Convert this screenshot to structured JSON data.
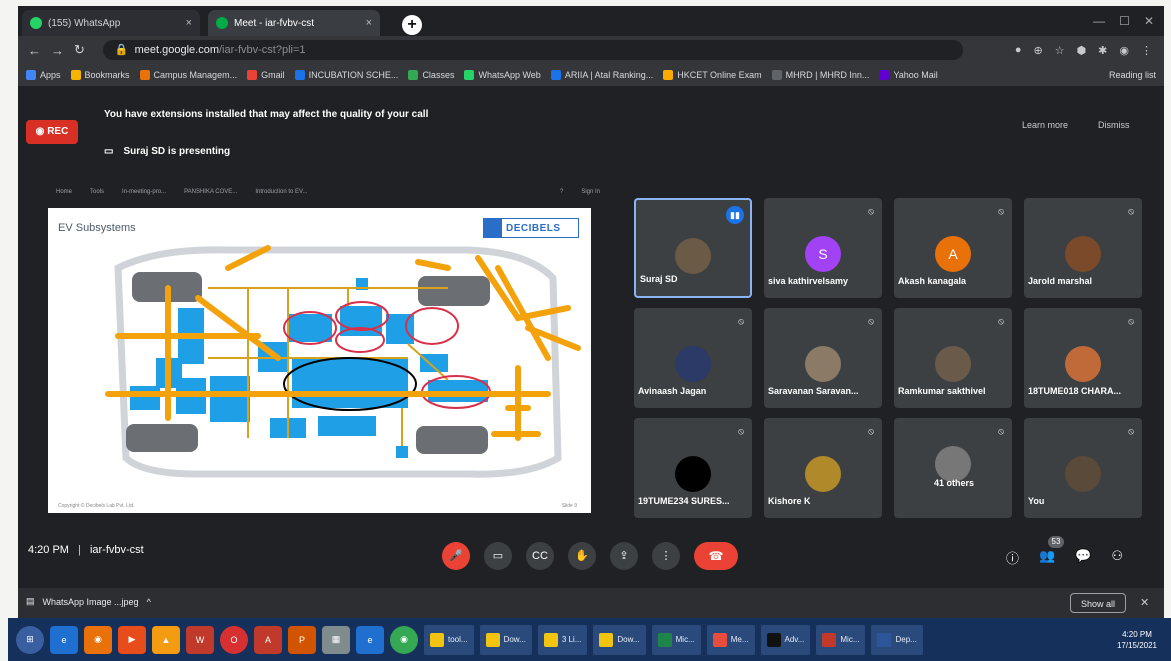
{
  "browser": {
    "tabs": [
      {
        "label": "(155) WhatsApp",
        "close": "×",
        "favicon_color": "#25d366"
      },
      {
        "label": "Meet - iar-fvbv-cst",
        "close": "×",
        "favicon_color": "#00ac47"
      }
    ],
    "new_tab": "+",
    "window_controls": [
      "—",
      "☐",
      "✕"
    ],
    "nav": {
      "back": "←",
      "forward": "→",
      "reload": "↻"
    },
    "url_host": "meet.google.com",
    "url_path": "/iar-fvbv-cst?pli=1",
    "toolbar_icons": [
      "●",
      "⊕",
      "☆",
      "⬢",
      "✱",
      "◉",
      "⋮"
    ],
    "bookmarks": [
      {
        "label": "Apps",
        "color": "#4285f4"
      },
      {
        "label": "Bookmarks",
        "color": "#f4b400"
      },
      {
        "label": "Campus Managem...",
        "color": "#e8710a"
      },
      {
        "label": "Gmail",
        "color": "#ea4335"
      },
      {
        "label": "INCUBATION SCHE...",
        "color": "#1a73e8"
      },
      {
        "label": "Classes",
        "color": "#34a853"
      },
      {
        "label": "WhatsApp Web",
        "color": "#25d366"
      },
      {
        "label": "ARIIA | Atal Ranking...",
        "color": "#1a73e8"
      },
      {
        "label": "HKCET Online Exam",
        "color": "#f9ab00"
      },
      {
        "label": "MHRD | MHRD Inn...",
        "color": "#5f6368"
      },
      {
        "label": "Yahoo Mail",
        "color": "#6001d2"
      }
    ],
    "reading_list": "Reading list"
  },
  "meet": {
    "rec_label": "REC",
    "extension_warning": "You have extensions installed that may affect the quality of your call",
    "learn_more": "Learn more",
    "dismiss": "Dismiss",
    "presenting": "Suraj SD is presenting",
    "meeting_time": "4:20 PM",
    "meeting_code": "iar-fvbv-cst",
    "slide_nav": [
      "Home",
      "Tools",
      "In-meeting-pro...",
      "PANSHIKA COVE...",
      "Introduction to EV...",
      "?",
      "Sign In"
    ],
    "slide": {
      "title": "EV Subsystems",
      "logo": "DECIBELS",
      "footer": "Copyright © Decibels Lab Pvt. Ltd.",
      "page": "Slide 9"
    },
    "participants": [
      {
        "name": "Suraj SD",
        "initial": "",
        "color": "#6b5a45",
        "mic": "",
        "speaking": true
      },
      {
        "name": "siva kathirvelsamy",
        "initial": "S",
        "color": "#a142f4",
        "mic": "🎤̸"
      },
      {
        "name": "Akash kanagala",
        "initial": "A",
        "color": "#e8710a",
        "mic": "🎤̸"
      },
      {
        "name": "Jarold marshal",
        "initial": "",
        "color": "#7a4a2a",
        "mic": "🎤̸"
      },
      {
        "name": "Avinaash Jagan",
        "initial": "",
        "color": "#2b3a66",
        "mic": "🎤̸"
      },
      {
        "name": "Saravanan Saravan...",
        "initial": "",
        "color": "#8a7a66",
        "mic": "🎤̸"
      },
      {
        "name": "Ramkumar sakthivel",
        "initial": "",
        "color": "#6a5a4a",
        "mic": "🎤̸"
      },
      {
        "name": "18TUME018 CHARA...",
        "initial": "",
        "color": "#c06a3a",
        "mic": "🎤̸"
      },
      {
        "name": "19TUME234 SURES...",
        "initial": "",
        "color": "#000000",
        "mic": "🎤̸"
      },
      {
        "name": "Kishore K",
        "initial": "",
        "color": "#b08a2a",
        "mic": "🎤̸"
      },
      {
        "name": "41 others",
        "initial": "",
        "color": "#777777",
        "mic": "🎤̸"
      },
      {
        "name": "You",
        "initial": "",
        "color": "#5a4a3a",
        "mic": "🎤̸"
      }
    ],
    "controls": [
      "🎤",
      "▭",
      "CC",
      "✋",
      "⇪",
      "⋮"
    ],
    "end_call": "☎",
    "right_controls": [
      "ⓘ",
      "👥",
      "💬",
      "⚇"
    ],
    "people_count": "53"
  },
  "download_shelf": {
    "file": "WhatsApp Image ...jpeg",
    "caret": "^",
    "show_all": "Show all",
    "close": "✕"
  },
  "taskbar": {
    "pinned": [
      {
        "label": "⊞",
        "color": "#3a5fa0"
      },
      {
        "label": "e",
        "color": "#1f6fd0"
      },
      {
        "label": "◉",
        "color": "#e8710a"
      },
      {
        "label": "▶",
        "color": "#e84c1a"
      },
      {
        "label": "▲",
        "color": "#f39c12"
      },
      {
        "label": "W",
        "color": "#c0392b"
      },
      {
        "label": "O",
        "color": "#d63031"
      },
      {
        "label": "A",
        "color": "#c0392b"
      },
      {
        "label": "P",
        "color": "#d35400"
      },
      {
        "label": "▦",
        "color": "#7f8c8d"
      },
      {
        "label": "e",
        "color": "#1f6fd0"
      },
      {
        "label": "◉",
        "color": "#34a853"
      }
    ],
    "windows": [
      {
        "label": "tool...",
        "color": "#f1c40f"
      },
      {
        "label": "Dow...",
        "color": "#f1c40f"
      },
      {
        "label": "3 Li...",
        "color": "#f1c40f"
      },
      {
        "label": "Dow...",
        "color": "#f1c40f"
      },
      {
        "label": "Mic...",
        "color": "#1e8449"
      },
      {
        "label": "Me...",
        "color": "#e74c3c"
      },
      {
        "label": "Adv...",
        "color": "#111111"
      },
      {
        "label": "Mic...",
        "color": "#c0392b"
      },
      {
        "label": "Dep...",
        "color": "#2b579a"
      }
    ],
    "time": "4:20 PM",
    "date": "17/15/2021"
  }
}
